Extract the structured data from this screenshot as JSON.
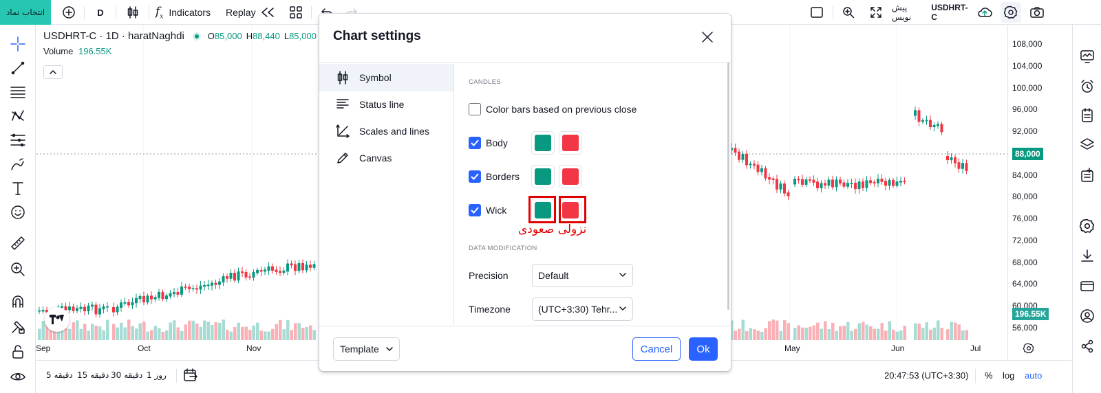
{
  "topbar": {
    "symbol_select": "انتخاب نماد",
    "interval": "D",
    "indicators": "Indicators",
    "replay": "Replay",
    "symbol_name": "USDHRT-C",
    "pre_market": "پیش نویس"
  },
  "legend": {
    "title": "USDHRT-C · 1D · haratNaghdi",
    "o_label": "O",
    "o_value": "85,000",
    "h_label": "H",
    "h_value": "88,440",
    "l_label": "L",
    "l_value": "85,000",
    "volume_label": "Volume",
    "volume_value": "196.55K"
  },
  "price_axis": {
    "labels": [
      "108,000",
      "104,000",
      "100,000",
      "96,000",
      "92,000",
      "88,000",
      "84,000",
      "80,000",
      "76,000",
      "72,000",
      "68,000",
      "64,000",
      "60,000",
      "56,000"
    ],
    "current_price": "88,000",
    "current_volume": "196.55K"
  },
  "time_axis": {
    "labels": [
      "Sep",
      "Oct",
      "Nov",
      "May",
      "Jun",
      "Jul"
    ]
  },
  "bottombar": {
    "ranges": [
      "5 دقیقه",
      "15 دقیقه",
      "30 دقیقه",
      "1 روز"
    ],
    "time": "20:47:53 (UTC+3:30)",
    "percent": "%",
    "log": "log",
    "auto": "auto"
  },
  "dialog": {
    "title": "Chart settings",
    "nav": [
      {
        "label": "Symbol",
        "icon": "candle-icon",
        "active": true
      },
      {
        "label": "Status line",
        "icon": "status-line-icon",
        "active": false
      },
      {
        "label": "Scales and lines",
        "icon": "scales-icon",
        "active": false
      },
      {
        "label": "Canvas",
        "icon": "pencil-icon",
        "active": false
      }
    ],
    "candles_section": "CANDLES",
    "color_bars_label": "Color bars based on previous close",
    "color_bars_checked": false,
    "rows": [
      {
        "label": "Body",
        "checked": true,
        "up_color": "#089981",
        "down_color": "#f23645"
      },
      {
        "label": "Borders",
        "checked": true,
        "up_color": "#089981",
        "down_color": "#f23645"
      },
      {
        "label": "Wick",
        "checked": true,
        "up_color": "#089981",
        "down_color": "#f23645"
      }
    ],
    "data_section": "DATA MODIFICATION",
    "precision_label": "Precision",
    "precision_value": "Default",
    "timezone_label": "Timezone",
    "timezone_value": "(UTC+3:30) Tehr...",
    "template_label": "Template",
    "cancel_label": "Cancel",
    "ok_label": "Ok"
  },
  "annotation": "نزولی صعودی",
  "colors": {
    "accent": "#2962ff",
    "up": "#089981",
    "down": "#f23645",
    "brand": "#26c6b2"
  }
}
